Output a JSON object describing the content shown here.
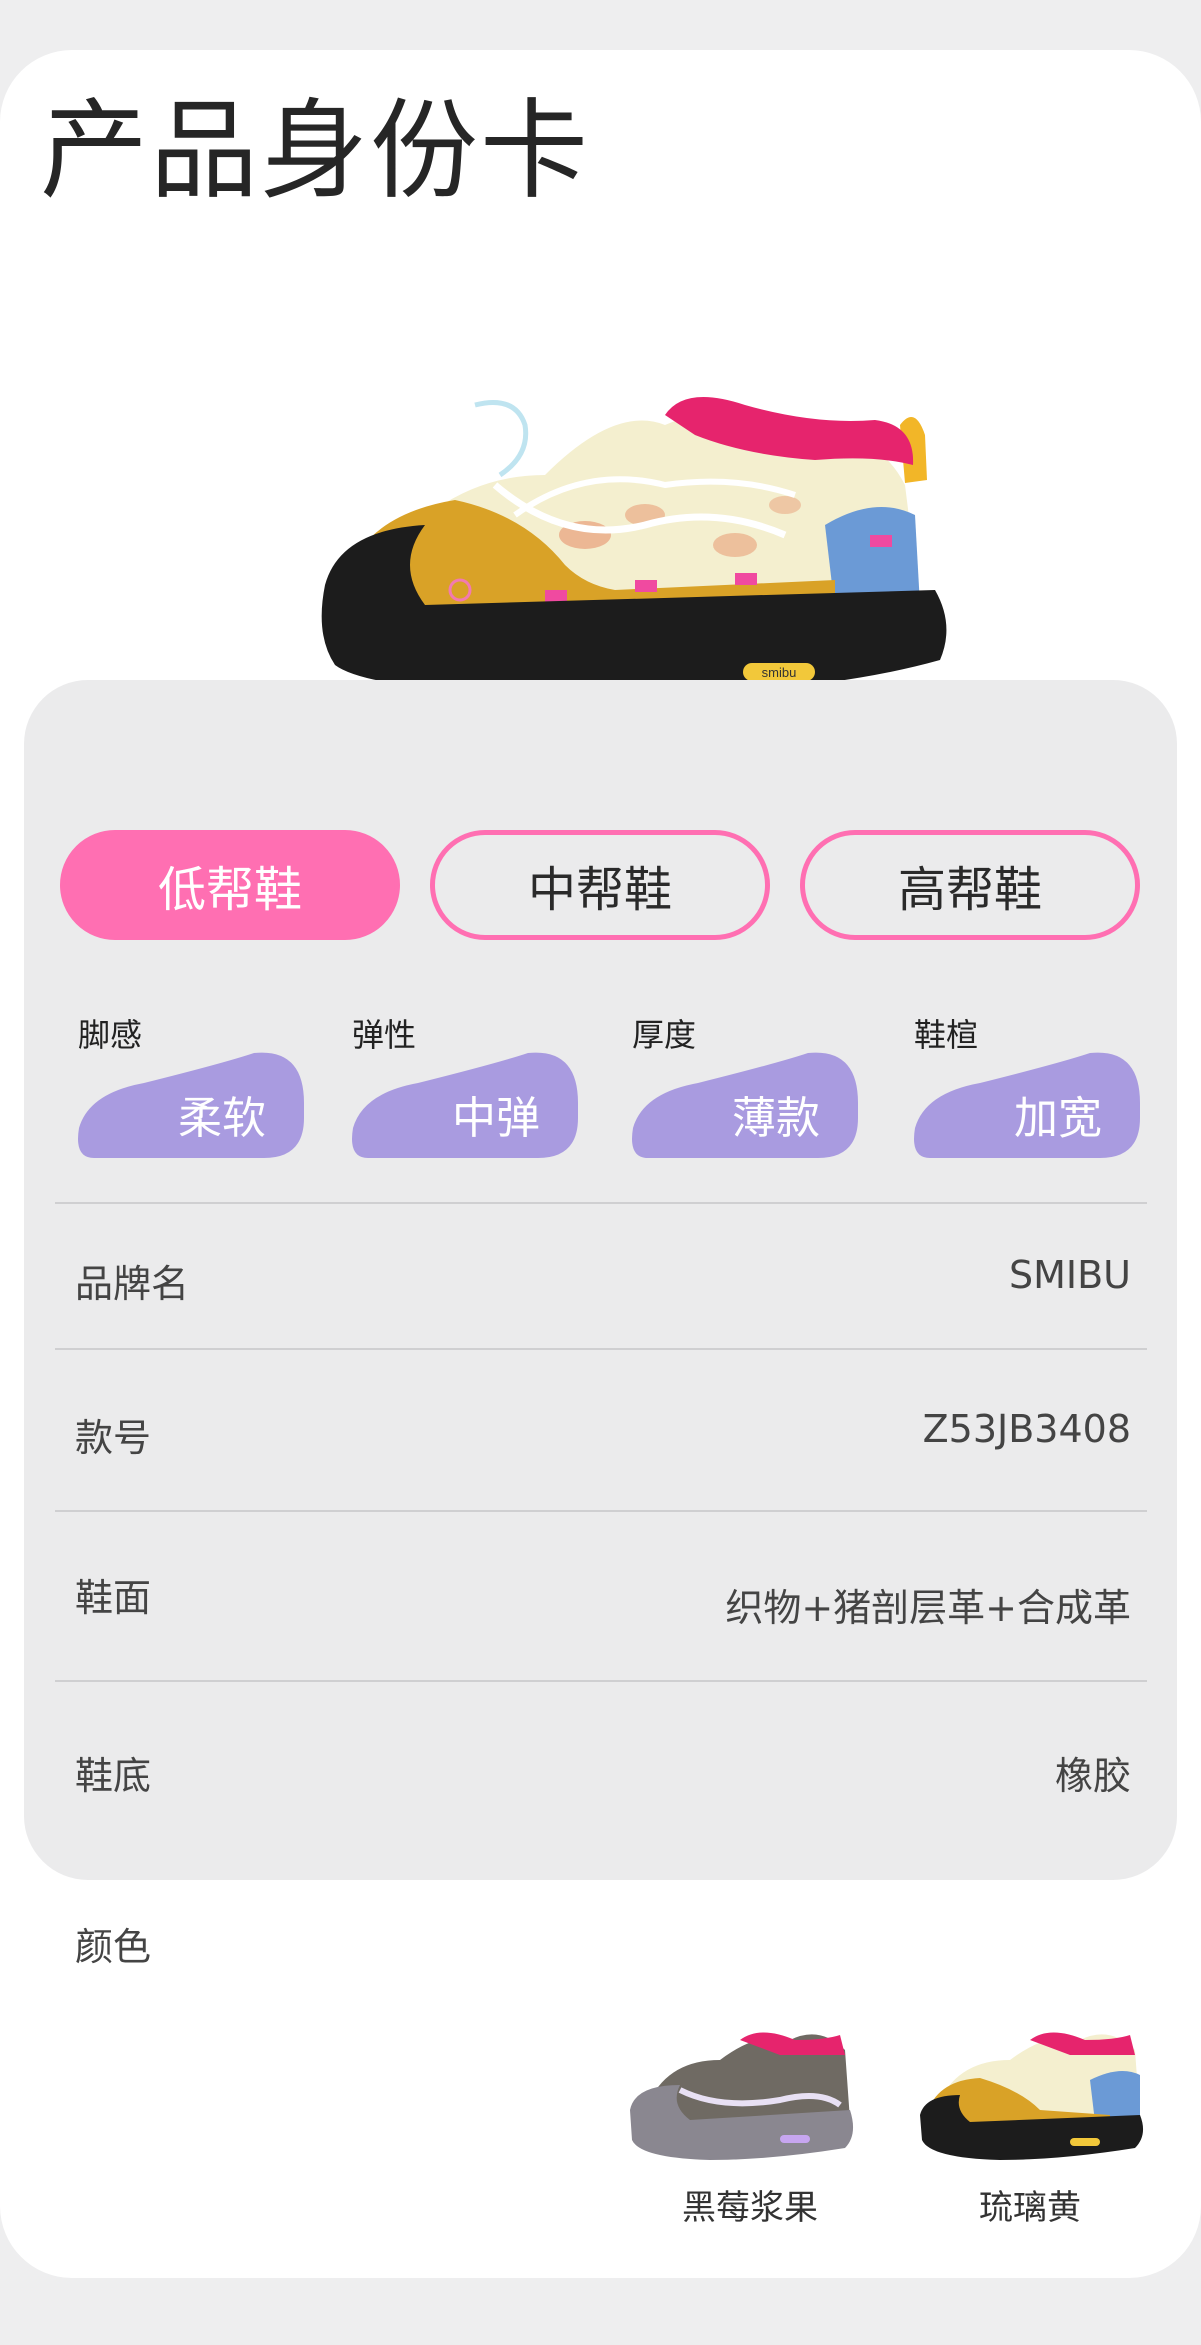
{
  "header": {
    "title": "产品身份卡"
  },
  "tabs": [
    {
      "label": "低帮鞋",
      "active": true
    },
    {
      "label": "中帮鞋",
      "active": false
    },
    {
      "label": "高帮鞋",
      "active": false
    }
  ],
  "attributes": [
    {
      "label": "脚感",
      "value": "柔软"
    },
    {
      "label": "弹性",
      "value": "中弹"
    },
    {
      "label": "厚度",
      "value": "薄款"
    },
    {
      "label": "鞋楦",
      "value": "加宽"
    }
  ],
  "specs": [
    {
      "label": "品牌名",
      "value": "SMIBU"
    },
    {
      "label": "款号",
      "value": "Z53JB3408"
    },
    {
      "label": "鞋面",
      "value": "织物+猪剖层革+合成革"
    },
    {
      "label": "鞋底",
      "value": "橡胶"
    }
  ],
  "colors": {
    "title": "颜色",
    "options": [
      {
        "name": "黑莓浆果"
      },
      {
        "name": "琉璃黄"
      }
    ]
  },
  "product_image": {
    "sole_logo": "smibu"
  },
  "theme": {
    "accent_pink": "#ff6fb2",
    "pill_purple": "#a99be0",
    "panel_grey": "#ebebec"
  }
}
